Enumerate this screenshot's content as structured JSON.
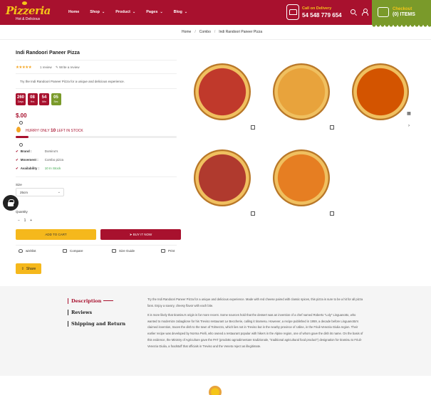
{
  "header": {
    "logo": {
      "title": "Pizzeria",
      "tagline": "Hot & Delicious"
    },
    "nav": [
      {
        "label": "Home",
        "has_dropdown": false
      },
      {
        "label": "Shop",
        "has_dropdown": true
      },
      {
        "label": "Product",
        "has_dropdown": true
      },
      {
        "label": "Pages",
        "has_dropdown": true
      },
      {
        "label": "Blog",
        "has_dropdown": true
      }
    ],
    "delivery": {
      "label": "Call on Delivery",
      "phone": "54 548 779 654"
    },
    "checkout": {
      "label": "Checkout",
      "items": "(0) ITEMS"
    }
  },
  "breadcrumb": [
    "Home",
    "Combo",
    "Indi Randoori Paneer Pizza"
  ],
  "product": {
    "title": "Indi Randoori Paneer Pizza",
    "rating": 5,
    "review_count": "1 review",
    "write_review": "Write a review",
    "short_desc": "Try the Indi Randoori Paneer Pizza for a unique and delicious experience.",
    "countdown": [
      {
        "value": "260",
        "unit": "Days"
      },
      {
        "value": "08",
        "unit": "Hrs"
      },
      {
        "value": "54",
        "unit": "Min"
      },
      {
        "value": "05",
        "unit": "Sec"
      }
    ],
    "price": "$.00",
    "hurry": {
      "prefix": "HURRY! ONLY",
      "count": "10",
      "suffix": "LEFT IN STOCK"
    },
    "stock_fraction": 0.08,
    "meta": [
      {
        "label": "Brand :",
        "value": "Domino's"
      },
      {
        "label": "Movement :",
        "value": "Combo pizza"
      },
      {
        "label": "Availability :",
        "value": "10 In Stock"
      }
    ],
    "size_label": "Size",
    "size_selected": "25cm",
    "quantity_label": "Quantity",
    "quantity_value": "1",
    "add_to_cart": "ADD TO CART",
    "buy_now": "BUY IT NOW",
    "actions": {
      "wishlist": "wishlist",
      "compare": "Compare",
      "size_guide": "Size Guide",
      "print": "Print"
    },
    "share": "Share"
  },
  "gallery": {
    "images": [
      "pizza-pepperoni",
      "pizza-margherita",
      "pizza-chili",
      "pizza-salami",
      "pizza-shrimp"
    ],
    "colors": [
      "#c0392b",
      "#e8a33c",
      "#d35400",
      "#b03a2e",
      "#e67e22"
    ]
  },
  "tabs": [
    "Description",
    "Reviews",
    "Shipping and Return"
  ],
  "description": {
    "p1": "Try the Indi Randoori Paneer Pizza for a unique and delicious experience. Made with red cheese paired with classic spices, this pizza is sure to be a hit for all pizza fans. Enjoy a savory, cheesy flavor with each bite.",
    "p2": "It is more likely that tiramisu's origin is far more recent. Some sources hold that the dessert was an invention of a chef named Roberto \"Loly\" Linguanotto, who wanted to modernize zabaglione for his Treviso restaurant Le Beccherie, calling it tiramesu. However, a recipe published in 1959, a decade before Linguanotto's claimed invention, traces the dish to the town of Tolmezzo, which lies not in Treviso but in the nearby province of Udine, in the Friuli-Venezia Giulia region. Their earlier recipe was developed by Norma Pielli, who owned a restaurant popular with hikers in the Alpine region, one of whom gave the dish its name. On the basis of this evidence, the Ministry of Agriculture gave the PAT (prodotto agroalimentare tradizionale, \"traditional agricultural food product\") designation for tiramisu to Friuli-Venezia Giulia, a foodstuff that officials in Treviso and the Veneto reject as illegitimate."
  }
}
